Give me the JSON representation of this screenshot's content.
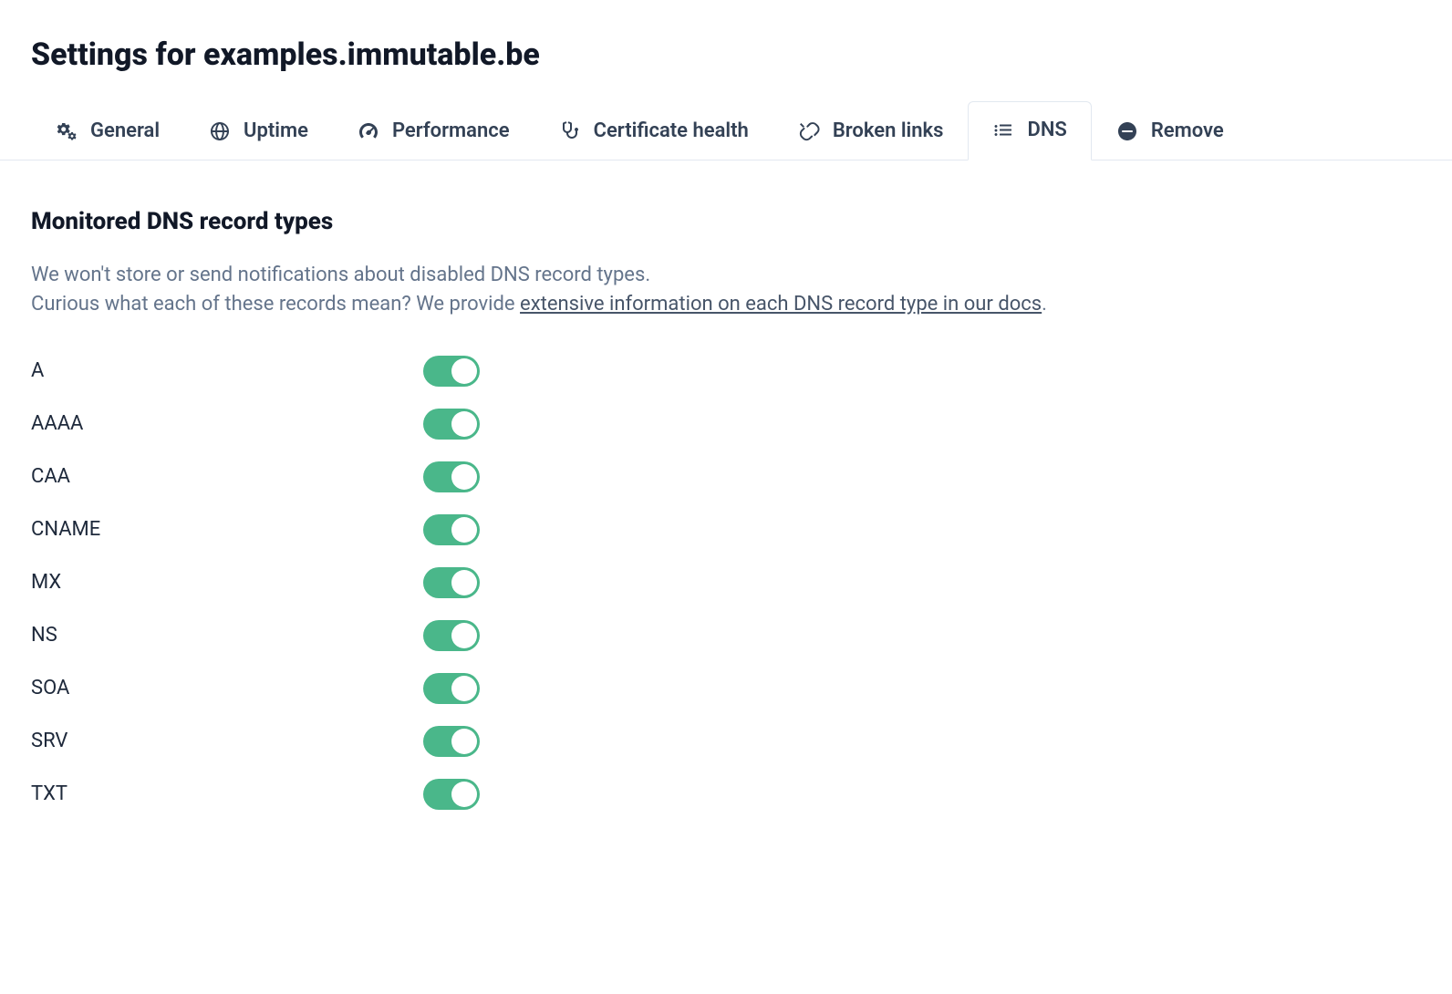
{
  "page": {
    "title": "Settings for examples.immutable.be"
  },
  "tabs": [
    {
      "id": "general",
      "label": "General",
      "icon": "gears-icon",
      "active": false
    },
    {
      "id": "uptime",
      "label": "Uptime",
      "icon": "globe-icon",
      "active": false
    },
    {
      "id": "performance",
      "label": "Performance",
      "icon": "gauge-icon",
      "active": false
    },
    {
      "id": "certificate",
      "label": "Certificate health",
      "icon": "stethoscope-icon",
      "active": false
    },
    {
      "id": "broken",
      "label": "Broken links",
      "icon": "unlink-icon",
      "active": false
    },
    {
      "id": "dns",
      "label": "DNS",
      "icon": "list-icon",
      "active": true
    },
    {
      "id": "remove",
      "label": "Remove",
      "icon": "minus-circle-icon",
      "active": false
    }
  ],
  "section": {
    "title": "Monitored DNS record types",
    "desc_line1": "We won't store or send notifications about disabled DNS record types.",
    "desc_line2_prefix": "Curious what each of these records mean? We provide ",
    "desc_link_text": "extensive information on each DNS record type in our docs",
    "desc_line2_suffix": "."
  },
  "records": [
    {
      "label": "A",
      "enabled": true
    },
    {
      "label": "AAAA",
      "enabled": true
    },
    {
      "label": "CAA",
      "enabled": true
    },
    {
      "label": "CNAME",
      "enabled": true
    },
    {
      "label": "MX",
      "enabled": true
    },
    {
      "label": "NS",
      "enabled": true
    },
    {
      "label": "SOA",
      "enabled": true
    },
    {
      "label": "SRV",
      "enabled": true
    },
    {
      "label": "TXT",
      "enabled": true
    }
  ],
  "colors": {
    "toggle_on": "#4ab78a",
    "text_muted": "#64748b"
  }
}
